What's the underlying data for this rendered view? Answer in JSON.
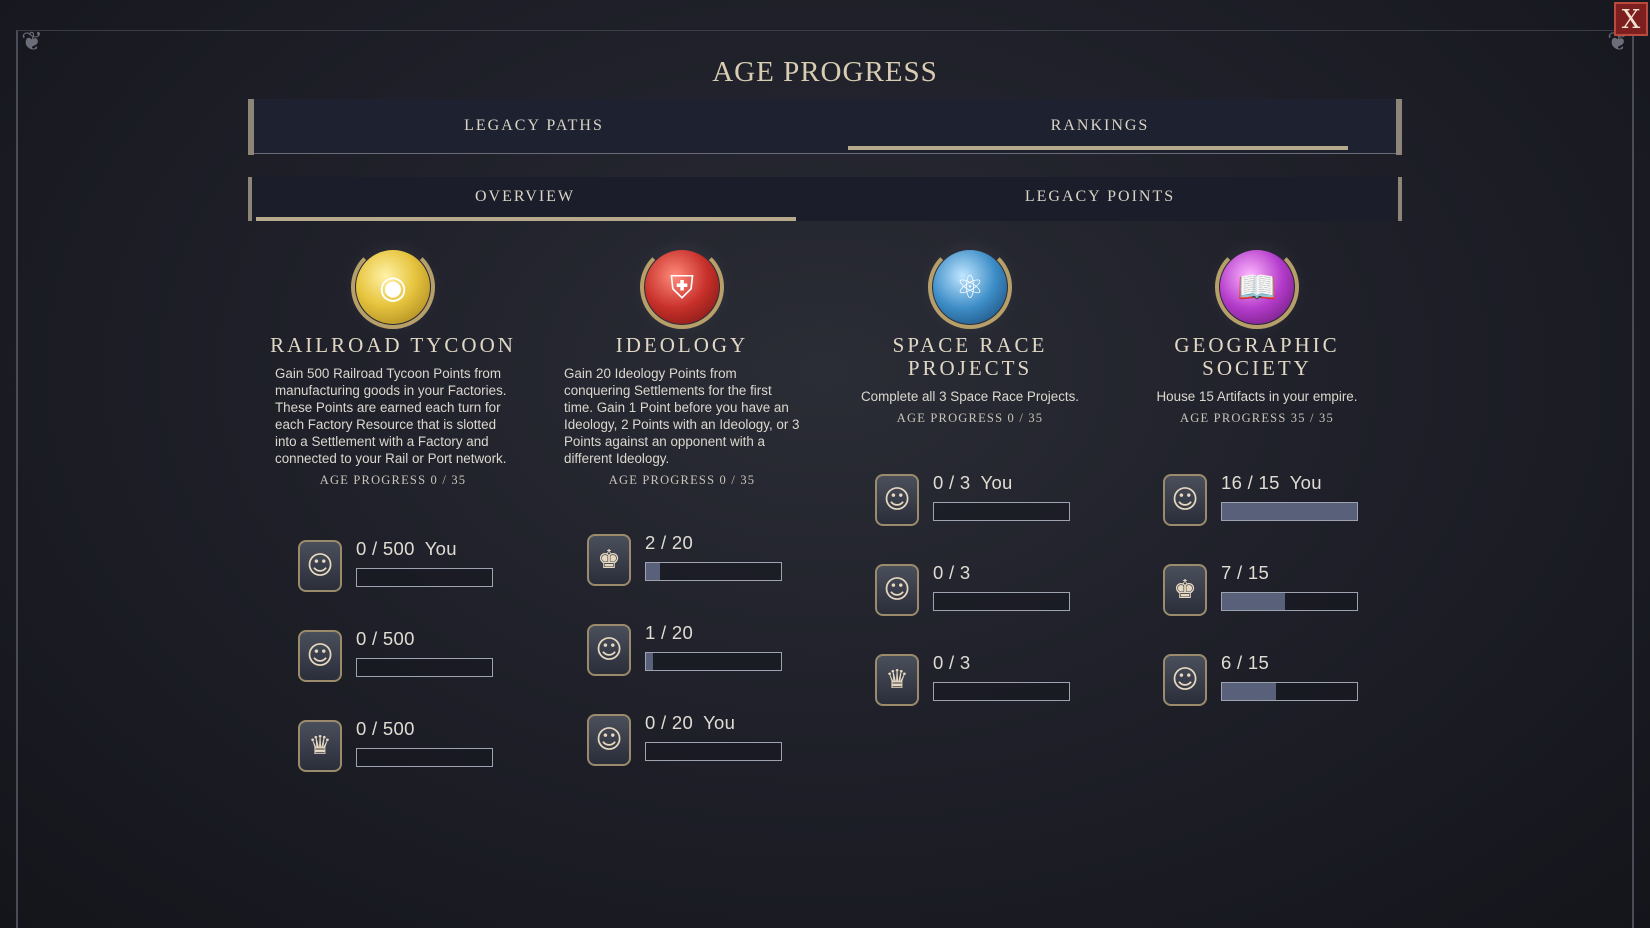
{
  "window": {
    "title": "AGE PROGRESS",
    "close_label": "X"
  },
  "tabs": [
    {
      "label": "LEGACY PATHS",
      "active": false
    },
    {
      "label": "RANKINGS",
      "active": true
    }
  ],
  "subtabs": [
    {
      "label": "OVERVIEW",
      "active": true
    },
    {
      "label": "LEGACY POINTS",
      "active": false
    }
  ],
  "columns": [
    {
      "title": "RAILROAD TYCOON",
      "icon": "gold-coins-icon",
      "description": "Gain 500 Railroad Tycoon Points from manufacturing goods in your Factories. These Points are earned each turn for each Factory Resource that is slotted into a Settlement with a Factory and connected to your Rail or Port network.",
      "age_progress": "AGE PROGRESS  0 / 35",
      "rows": [
        {
          "portrait": "leader-portrait-bearded-man",
          "value": "0 / 500",
          "you": "You",
          "fraction": 0
        },
        {
          "portrait": "leader-portrait-white-haired-woman",
          "value": "0 / 500",
          "you": "",
          "fraction": 0
        },
        {
          "portrait": "leader-portrait-crowned-woman",
          "value": "0 / 500",
          "you": "",
          "fraction": 0
        }
      ]
    },
    {
      "title": "IDEOLOGY",
      "icon": "shield-sword-icon",
      "description": "Gain 20 Ideology Points from conquering Settlements for the first time. Gain 1 Point before you have an Ideology, 2 Points with an Ideology, or 3 Points against an opponent with a different Ideology.",
      "age_progress": "AGE PROGRESS  0 / 35",
      "rows": [
        {
          "portrait": "leader-portrait-bearded-king",
          "value": "2 / 20",
          "you": "",
          "fraction": 0.1
        },
        {
          "portrait": "leader-portrait-ruffled-collar-man",
          "value": "1 / 20",
          "you": "",
          "fraction": 0.05
        },
        {
          "portrait": "leader-portrait-bearded-man",
          "value": "0 / 20",
          "you": "You",
          "fraction": 0
        }
      ]
    },
    {
      "title": "SPACE RACE PROJECTS",
      "icon": "atom-icon",
      "description": "Complete all 3 Space Race Projects.",
      "age_progress": "AGE PROGRESS  0 / 35",
      "rows": [
        {
          "portrait": "leader-portrait-bearded-man",
          "value": "0 / 3",
          "you": "You",
          "fraction": 0
        },
        {
          "portrait": "leader-portrait-white-haired-woman",
          "value": "0 / 3",
          "you": "",
          "fraction": 0
        },
        {
          "portrait": "leader-portrait-crowned-woman",
          "value": "0 / 3",
          "you": "",
          "fraction": 0
        }
      ]
    },
    {
      "title": "GEOGRAPHIC SOCIETY",
      "icon": "open-book-icon",
      "description": "House 15 Artifacts in your empire.",
      "age_progress": "AGE PROGRESS  35 / 35",
      "rows": [
        {
          "portrait": "leader-portrait-bearded-man",
          "value": "16 / 15",
          "you": "You",
          "fraction": 1
        },
        {
          "portrait": "leader-portrait-bearded-king",
          "value": "7 / 15",
          "you": "",
          "fraction": 0.467
        },
        {
          "portrait": "leader-portrait-ruffled-collar-man",
          "value": "6 / 15",
          "you": "",
          "fraction": 0.4
        }
      ]
    }
  ]
}
